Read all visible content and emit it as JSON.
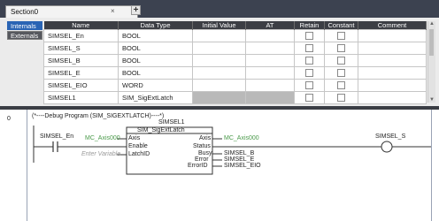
{
  "tabbar": {
    "tab_label": "Section0",
    "close_glyph": "×",
    "add_glyph": "+"
  },
  "sidebar": {
    "tabs": [
      {
        "label": "Internals",
        "active": true
      },
      {
        "label": "Externals",
        "active": false
      }
    ]
  },
  "variables": {
    "headers": {
      "name": "Name",
      "type": "Data Type",
      "initial": "Initial Value",
      "at": "AT",
      "retain": "Retain",
      "constant": "Constant",
      "comment": "Comment"
    },
    "rows": [
      {
        "name": "SIMSEL_En",
        "type": "BOOL"
      },
      {
        "name": "SIMSEL_S",
        "type": "BOOL"
      },
      {
        "name": "SIMSEL_B",
        "type": "BOOL"
      },
      {
        "name": "SIMSEL_E",
        "type": "BOOL"
      },
      {
        "name": "SIMSEL_EIO",
        "type": "WORD"
      },
      {
        "name": "SIMSEL1",
        "type": "SIM_SigExtLatch"
      }
    ]
  },
  "ladder": {
    "rung_number": "0",
    "comment": "(*----Debug Program (SIM_SIGEXTLATCH)----*)",
    "instance_name": "SIMSEL1",
    "fb_type": "SIM_SigExtLatch",
    "contact_var": "SIMSEL_En",
    "coil_var": "SIMSEL_S",
    "axis_in_var": "MC_Axis000",
    "axis_out_var": "MC_Axis000",
    "latch_placeholder": "Enter Variable",
    "pins": {
      "left": [
        "Axis",
        "Enable",
        "LatchID"
      ],
      "right": [
        "Axis",
        "Status",
        "Busy",
        "Error",
        "ErrorID"
      ]
    },
    "out_vars": {
      "busy": "SIMSEL_B",
      "error": "SIMSEL_E",
      "errorid": "SIMSEL_EIO"
    }
  }
}
